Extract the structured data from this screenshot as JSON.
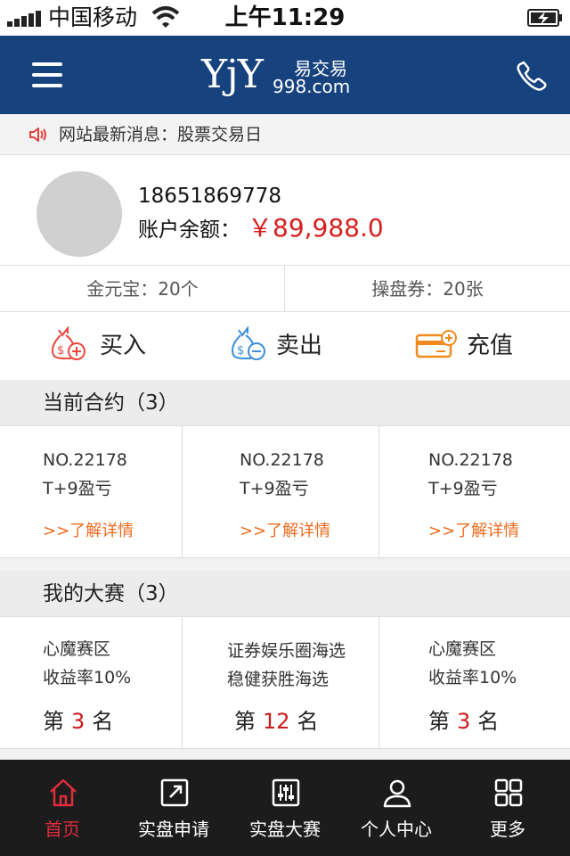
{
  "status_bar": {
    "carrier": "中国移动",
    "time": "上午11:29"
  },
  "header": {
    "logo_main": "YjY",
    "logo_cn": "易交易",
    "logo_url": "998.com",
    "menu_icon": "hamburger-menu-icon",
    "phone_icon": "phone-icon"
  },
  "news": {
    "icon": "speaker-icon",
    "text": "网站最新消息：股票交易日"
  },
  "profile": {
    "phone": "18651869778",
    "balance_label": "账户余额：",
    "balance_value": "￥89,988.0"
  },
  "stats": [
    {
      "label": "金元宝：20个"
    },
    {
      "label": "操盘券：20张"
    }
  ],
  "actions": [
    {
      "label": "买入",
      "icon": "money-bag-plus-icon",
      "color": "#e8483c"
    },
    {
      "label": "卖出",
      "icon": "money-bag-minus-icon",
      "color": "#3b8fd8"
    },
    {
      "label": "充值",
      "icon": "card-plus-icon",
      "color": "#f08a1c"
    }
  ],
  "contracts": {
    "title": "当前合约（3）",
    "items": [
      {
        "no": "NO.22178",
        "type": "T+9盈亏",
        "link": ">>了解详情"
      },
      {
        "no": "NO.22178",
        "type": "T+9盈亏",
        "link": ">>了解详情"
      },
      {
        "no": "NO.22178",
        "type": "T+9盈亏",
        "link": ">>了解详情"
      }
    ]
  },
  "contests": {
    "title": "我的大赛（3）",
    "items": [
      {
        "line1": "心魔赛区",
        "line2": "收益率10%",
        "rank_prefix": "第",
        "rank": "3",
        "rank_suffix": "名"
      },
      {
        "line1": "证券娱乐圈海选",
        "line2": "稳健获胜海选",
        "rank_prefix": "第",
        "rank": "12",
        "rank_suffix": "名"
      },
      {
        "line1": "心魔赛区",
        "line2": "收益率10%",
        "rank_prefix": "第",
        "rank": "3",
        "rank_suffix": "名"
      }
    ]
  },
  "tabbar": [
    {
      "label": "首页",
      "icon": "home-icon",
      "active": true
    },
    {
      "label": "实盘申请",
      "icon": "external-link-icon",
      "active": false
    },
    {
      "label": "实盘大赛",
      "icon": "sliders-icon",
      "active": false
    },
    {
      "label": "个人中心",
      "icon": "user-icon",
      "active": false
    },
    {
      "label": "更多",
      "icon": "grid-icon",
      "active": false
    }
  ],
  "colors": {
    "nav_bg": "#16427e",
    "price_red": "#d81e1e",
    "link_orange": "#ee6a1e",
    "tab_active": "#e02c3c",
    "tabbar_bg": "#1c1c1c"
  }
}
